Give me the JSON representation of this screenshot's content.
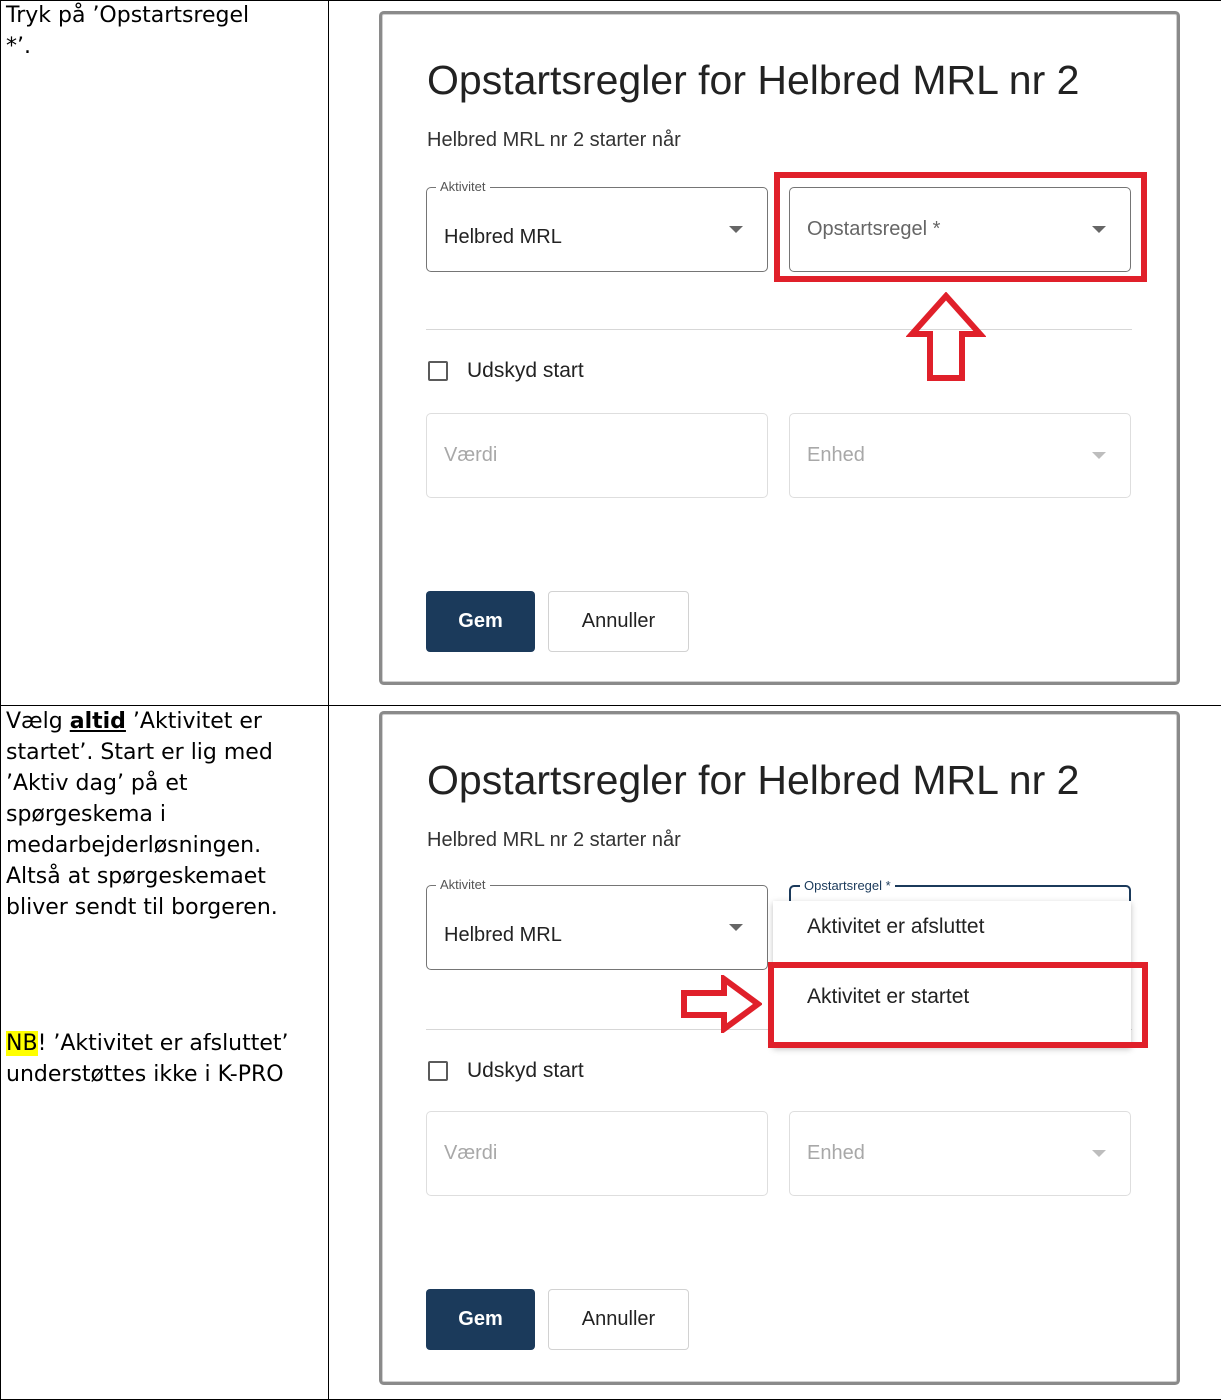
{
  "row1": {
    "instruction": "Tryk på ’Opstartsregel *’.",
    "dialog": {
      "title": "Opstartsregler for Helbred MRL nr 2",
      "subtitle": "Helbred MRL nr 2 starter når",
      "activity_label": "Aktivitet",
      "activity_value": "Helbred MRL",
      "rule_placeholder": "Opstartsregel *",
      "postpone_label": "Udskyd start",
      "value_placeholder": "Værdi",
      "unit_placeholder": "Enhed",
      "save_label": "Gem",
      "cancel_label": "Annuller"
    }
  },
  "row2": {
    "instruction_prefix": "Vælg ",
    "instruction_bold": "altid",
    "instruction_rest": " ’Aktivitet er startet’. Start er lig med ’Aktiv dag’ på et spørgeskema i medarbejderløsningen. Altså at spørgeskemaet bliver sendt til borgeren.",
    "note_highlight": "NB",
    "note_rest": "! ’Aktivitet er afsluttet’ understøttes ikke i K-PRO",
    "dialog": {
      "title": "Opstartsregler for Helbred MRL nr 2",
      "subtitle": "Helbred MRL nr 2 starter når",
      "activity_label": "Aktivitet",
      "activity_value": "Helbred MRL",
      "rule_label": "Opstartsregel *",
      "menu_options": [
        "Aktivitet er afsluttet",
        "Aktivitet er startet"
      ],
      "postpone_label": "Udskyd start",
      "value_placeholder": "Værdi",
      "unit_placeholder": "Enhed",
      "save_label": "Gem",
      "cancel_label": "Annuller"
    }
  },
  "colors": {
    "accent": "#1b3a5b",
    "highlight_box": "#e0202a",
    "note_highlight": "#ffff00"
  },
  "icons": [
    "chevron-down-icon",
    "up-arrow-icon",
    "right-arrow-icon",
    "checkbox-icon"
  ]
}
